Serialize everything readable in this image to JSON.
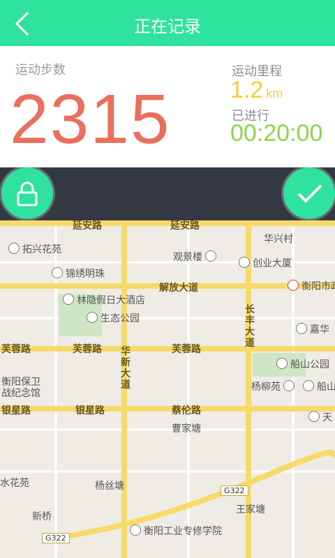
{
  "header": {
    "title": "正在记录"
  },
  "stats": {
    "steps_label": "运动步数",
    "steps_value": "2315",
    "distance_label": "运动里程",
    "distance_value": "1.2",
    "distance_unit": "km",
    "elapsed_label": "已进行",
    "elapsed_value": "00:20:00"
  },
  "controls": {
    "lock_icon": "lock-icon",
    "confirm_icon": "check-icon"
  },
  "map": {
    "roads": [
      "延安路",
      "延安路",
      "解放大道",
      "芙蓉路",
      "芙蓉路",
      "芙蓉路",
      "银星路",
      "银星路",
      "蔡伦路",
      "华新大道",
      "长丰大道"
    ],
    "places": [
      "拓兴花苑",
      "锦绣明珠",
      "观景楼",
      "华兴村",
      "创业大厦",
      "衡阳市政",
      "林隐假日大酒店",
      "生态公园",
      "嘉华",
      "船山公园",
      "衡阳保卫战纪念馆",
      "杨柳苑",
      "船山",
      "天",
      "曹家塘",
      "水花苑",
      "杨丝塘",
      "新桥",
      "王家塘",
      "衡阳工业专修学院",
      "G322",
      "G322"
    ]
  }
}
